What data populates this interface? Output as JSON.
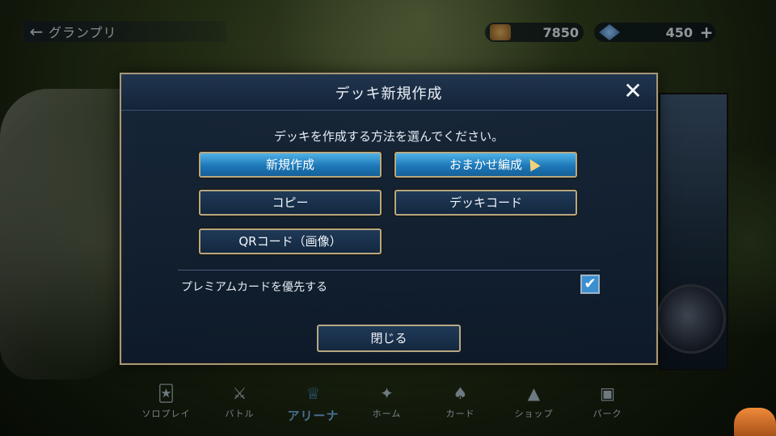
{
  "topbar": {
    "back_label": "グランプリ",
    "gold": "7850",
    "crystal": "450"
  },
  "modal": {
    "title": "デッキ新規作成",
    "prompt": "デッキを作成する方法を選んでください。",
    "options": {
      "new": "新規作成",
      "auto": "おまかせ編成",
      "copy": "コピー",
      "deck_code": "デッキコード",
      "qr": "QRコード（画像）"
    },
    "premium_label": "プレミアムカードを優先する",
    "premium_checked": true,
    "close_label": "閉じる"
  },
  "nav": {
    "items": [
      {
        "label": "ソロプレイ",
        "icon": "solo-play-icon"
      },
      {
        "label": "バトル",
        "icon": "battle-icon"
      },
      {
        "label": "アリーナ",
        "icon": "trophy-icon",
        "active": true
      },
      {
        "label": "ホーム",
        "icon": "home-icon"
      },
      {
        "label": "カード",
        "icon": "cards-icon"
      },
      {
        "label": "ショップ",
        "icon": "shop-icon"
      },
      {
        "label": "パーク",
        "icon": "park-icon"
      }
    ]
  },
  "colors": {
    "accent": "#1d78b8",
    "frame": "#b8a882",
    "modal_bg": "#16263a"
  }
}
